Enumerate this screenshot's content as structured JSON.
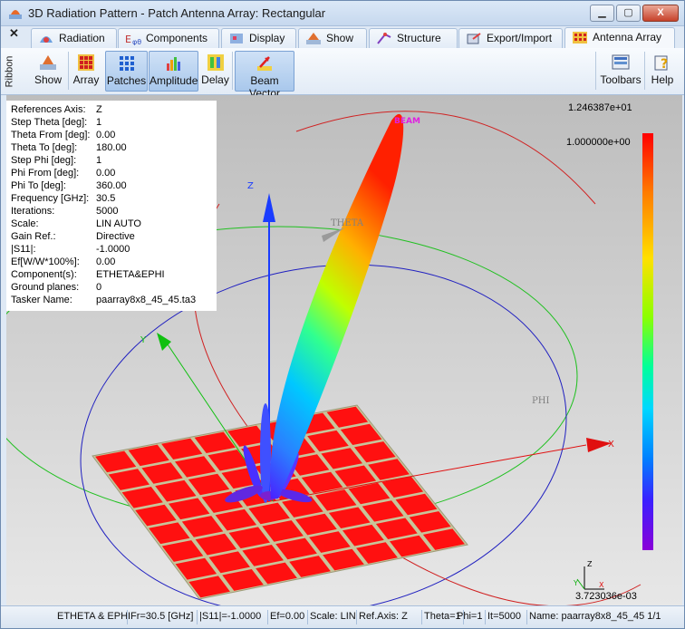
{
  "window": {
    "title": "3D Radiation Pattern - Patch Antenna Array: Rectangular",
    "minimize": "▁",
    "maximize": "▢",
    "close": "X",
    "ribbon_close": "✕",
    "ribbon_label": "Ribbon"
  },
  "tabs": [
    {
      "label": "Radiation",
      "icon": "radiation-icon"
    },
    {
      "label": "Components",
      "icon": "components-icon"
    },
    {
      "label": "Display",
      "icon": "display-icon"
    },
    {
      "label": "Show",
      "icon": "show-icon"
    },
    {
      "label": "Structure",
      "icon": "structure-icon"
    },
    {
      "label": "Export/Import",
      "icon": "export-import-icon"
    },
    {
      "label": "Antenna Array",
      "icon": "antenna-array-icon",
      "active": true
    }
  ],
  "ribbon": {
    "show": "Show",
    "array": "Array",
    "patches": "Patches",
    "amplitude": "Amplitude",
    "delay": "Delay",
    "beam_vector": "Beam Vector",
    "toolbars": "Toolbars",
    "help": "Help"
  },
  "info": [
    {
      "key": "References Axis:",
      "value": "Z"
    },
    {
      "key": "Step Theta [deg]:",
      "value": "1"
    },
    {
      "key": "Theta From [deg]:",
      "value": "0.00"
    },
    {
      "key": "Theta To [deg]:",
      "value": "180.00"
    },
    {
      "key": "Step Phi [deg]:",
      "value": "1"
    },
    {
      "key": "Phi From [deg]:",
      "value": "0.00"
    },
    {
      "key": "Phi To [deg]:",
      "value": "360.00"
    },
    {
      "key": "Frequency [GHz]:",
      "value": "30.5"
    },
    {
      "key": "Iterations:",
      "value": "5000"
    },
    {
      "key": "Scale:",
      "value": "LIN AUTO"
    },
    {
      "key": "Gain Ref.:",
      "value": "Directive"
    },
    {
      "key": "|S11|:",
      "value": "-1.0000"
    },
    {
      "key": "Ef[W/W*100%]:",
      "value": "0.00"
    },
    {
      "key": "Component(s):",
      "value": "ETHETA&EPHI"
    },
    {
      "key": "Ground planes:",
      "value": "0"
    },
    {
      "key": "Tasker Name:",
      "value": "paarray8x8_45_45.ta3"
    }
  ],
  "scene": {
    "axis_z": "Z",
    "axis_y": "Y",
    "axis_x": "X",
    "theta_label": "THETA",
    "phi_label": "PHI",
    "beam_label": "BEAM",
    "mini_x": "X",
    "mini_y": "Y",
    "mini_z": "Z"
  },
  "scale": {
    "max": "1.246387e+01",
    "ref": "1.000000e+00",
    "min": "3.723036e-03"
  },
  "status": {
    "component": "ETHETA & EPHI",
    "freq": "Fr=30.5 [GHz]",
    "s11": "|S11|=-1.0000",
    "ef": "Ef=0.00",
    "scale": "Scale: LIN",
    "ref_axis": "Ref.Axis: Z",
    "theta": "Theta=1",
    "phi": "Phi=1",
    "it": "It=5000",
    "name": "Name: paarray8x8_45_45 1/1"
  },
  "colors": {
    "patch": "#ff1010",
    "ground": "#c8c49a",
    "axis_z": "#1a3cff",
    "axis_x": "#e01010",
    "axis_y": "#10c010"
  }
}
